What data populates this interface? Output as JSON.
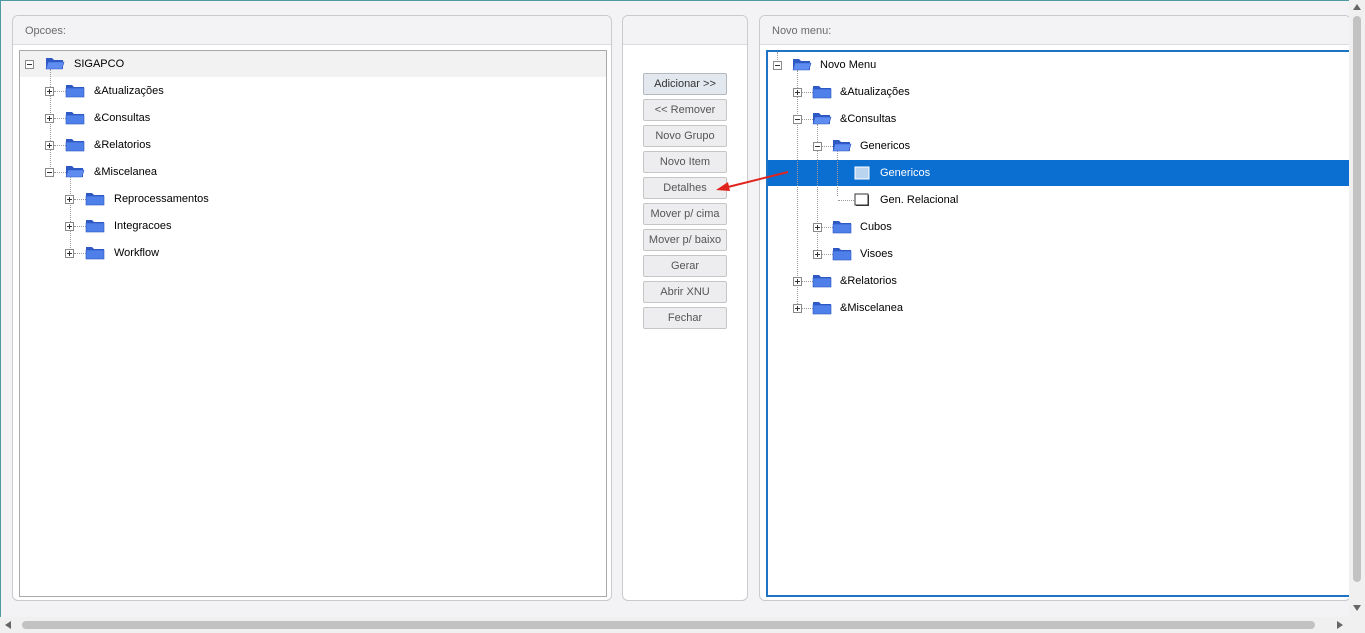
{
  "left_panel": {
    "title": "Opcoes:",
    "root": "SIGAPCO",
    "items": [
      "&Atualizações",
      "&Consultas",
      "&Relatorios",
      "&Miscelanea"
    ],
    "miscelanea_children": [
      "Reprocessamentos",
      "Integracoes",
      "Workflow"
    ]
  },
  "buttons": {
    "add": "Adicionar >>",
    "remove": "<< Remover",
    "new_group": "Novo Grupo",
    "new_item": "Novo Item",
    "details": "Detalhes",
    "move_up": "Mover p/ cima",
    "move_down": "Mover p/ baixo",
    "generate": "Gerar",
    "open_xnu": "Abrir XNU",
    "close": "Fechar"
  },
  "right_panel": {
    "title": "Novo menu:",
    "root": "Novo Menu",
    "atualizacoes": "&Atualizações",
    "consultas": "&Consultas",
    "genericos_group": "Genericos",
    "genericos_item": "Genericos",
    "gen_relacional": "Gen. Relacional",
    "cubos": "Cubos",
    "visoes": "Visoes",
    "relatorios": "&Relatorios",
    "miscelanea": "&Miscelanea"
  },
  "colors": {
    "selection": "#0a6fd1",
    "folder": "#3d68d8",
    "annotation_arrow": "#e0231c"
  }
}
